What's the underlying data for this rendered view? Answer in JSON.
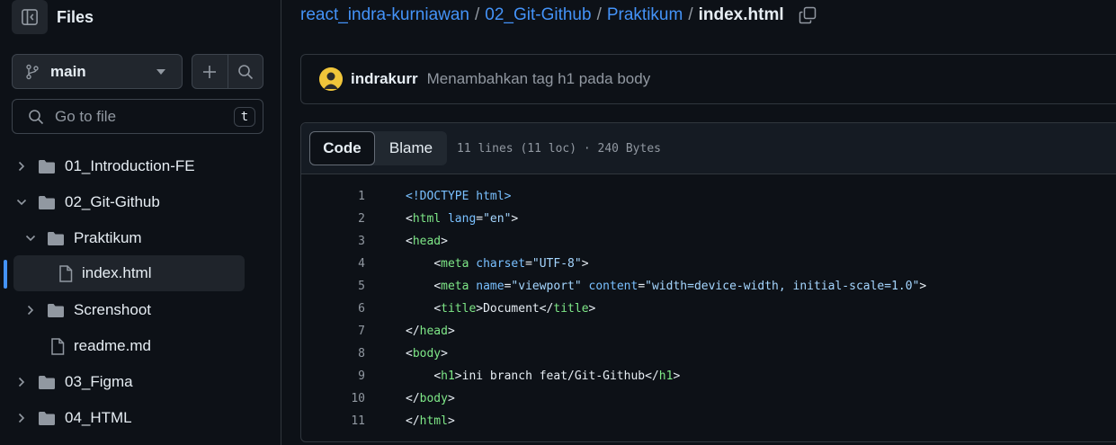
{
  "sidebar": {
    "title": "Files",
    "branch": "main",
    "goto_placeholder": "Go to file",
    "goto_shortcut": "t",
    "tree": [
      {
        "label": "01_Introduction-FE",
        "type": "folder",
        "expanded": false,
        "depth": 0
      },
      {
        "label": "02_Git-Github",
        "type": "folder",
        "expanded": true,
        "depth": 0
      },
      {
        "label": "Praktikum",
        "type": "folder",
        "expanded": true,
        "depth": 1
      },
      {
        "label": "index.html",
        "type": "file",
        "selected": true,
        "depth": 2
      },
      {
        "label": "Screnshoot",
        "type": "folder",
        "expanded": false,
        "depth": 1
      },
      {
        "label": "readme.md",
        "type": "file",
        "depth": 1
      },
      {
        "label": "03_Figma",
        "type": "folder",
        "expanded": false,
        "depth": 0
      },
      {
        "label": "04_HTML",
        "type": "folder",
        "expanded": false,
        "depth": 0
      }
    ]
  },
  "breadcrumb": {
    "repo": "react_indra-kurniawan",
    "folder1": "02_Git-Github",
    "folder2": "Praktikum",
    "file": "index.html",
    "sep": "/"
  },
  "commit": {
    "author": "indrakurr",
    "message": "Menambahkan tag h1 pada body"
  },
  "code": {
    "tab_code": "Code",
    "tab_blame": "Blame",
    "info": "11 lines (11 loc) · 240 Bytes",
    "lines": [
      {
        "n": "1",
        "text": "<!DOCTYPE html>"
      },
      {
        "n": "2",
        "text": "<html lang=\"en\">"
      },
      {
        "n": "3",
        "text": "<head>"
      },
      {
        "n": "4",
        "text": "    <meta charset=\"UTF-8\">"
      },
      {
        "n": "5",
        "text": "    <meta name=\"viewport\" content=\"width=device-width, initial-scale=1.0\">"
      },
      {
        "n": "6",
        "text": "    <title>Document</title>"
      },
      {
        "n": "7",
        "text": "</head>"
      },
      {
        "n": "8",
        "text": "<body>"
      },
      {
        "n": "9",
        "text": "    <h1>ini branch feat/Git-Github</h1>"
      },
      {
        "n": "10",
        "text": "</body>"
      },
      {
        "n": "11",
        "text": "</html>"
      }
    ]
  },
  "colors": {
    "link": "#4493f8",
    "tag": "#7ee787",
    "attr": "#79c0ff",
    "string": "#a5d6ff",
    "accent_bar": "#4493f8"
  }
}
